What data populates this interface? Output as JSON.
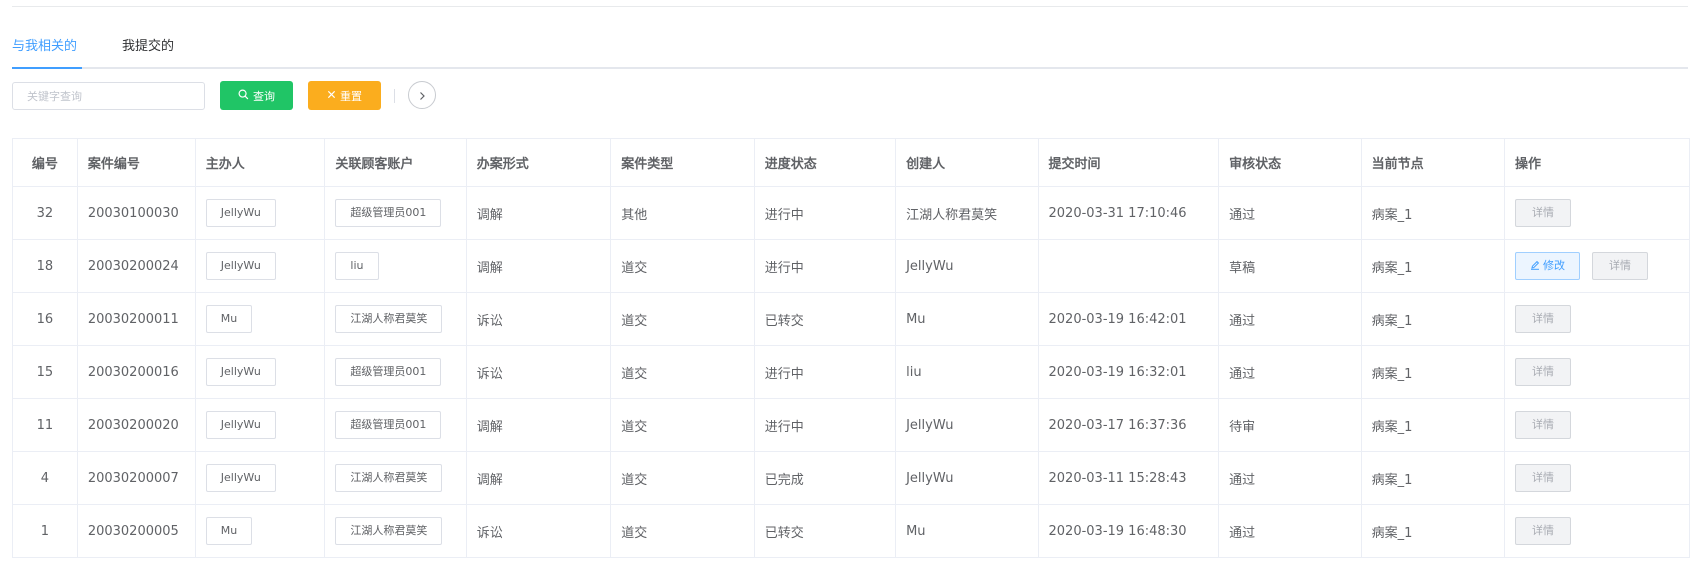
{
  "tabs": {
    "related": "与我相关的",
    "submitted": "我提交的"
  },
  "toolbar": {
    "search_placeholder": "关键字查询",
    "query_label": "查询",
    "reset_label": "重置",
    "colors": {
      "query": "#20c566",
      "reset": "#fbad1e",
      "accent": "#409eff"
    }
  },
  "table": {
    "headers": [
      "编号",
      "案件编号",
      "主办人",
      "关联顾客账户",
      "办案形式",
      "案件类型",
      "进度状态",
      "创建人",
      "提交时间",
      "审核状态",
      "当前节点",
      "操作"
    ],
    "detail_label": "详情",
    "edit_label": "修改",
    "rows": [
      {
        "id": "32",
        "case_no": "20030100030",
        "host": "JellyWu",
        "account": "超级管理员001",
        "mode": "调解",
        "type": "其他",
        "progress": "进行中",
        "creator": "江湖人称君莫笑",
        "time": "2020-03-31 17:10:46",
        "review": "通过",
        "node": "病案_1",
        "editable": false
      },
      {
        "id": "18",
        "case_no": "20030200024",
        "host": "JellyWu",
        "account": "liu",
        "mode": "调解",
        "type": "道交",
        "progress": "进行中",
        "creator": "JellyWu",
        "time": "",
        "review": "草稿",
        "node": "病案_1",
        "editable": true
      },
      {
        "id": "16",
        "case_no": "20030200011",
        "host": "Mu",
        "account": "江湖人称君莫笑",
        "mode": "诉讼",
        "type": "道交",
        "progress": "已转交",
        "creator": "Mu",
        "time": "2020-03-19 16:42:01",
        "review": "通过",
        "node": "病案_1",
        "editable": false
      },
      {
        "id": "15",
        "case_no": "20030200016",
        "host": "JellyWu",
        "account": "超级管理员001",
        "mode": "诉讼",
        "type": "道交",
        "progress": "进行中",
        "creator": "liu",
        "time": "2020-03-19 16:32:01",
        "review": "通过",
        "node": "病案_1",
        "editable": false
      },
      {
        "id": "11",
        "case_no": "20030200020",
        "host": "JellyWu",
        "account": "超级管理员001",
        "mode": "调解",
        "type": "道交",
        "progress": "进行中",
        "creator": "JellyWu",
        "time": "2020-03-17 16:37:36",
        "review": "待审",
        "node": "病案_1",
        "editable": false
      },
      {
        "id": "4",
        "case_no": "20030200007",
        "host": "JellyWu",
        "account": "江湖人称君莫笑",
        "mode": "调解",
        "type": "道交",
        "progress": "已完成",
        "creator": "JellyWu",
        "time": "2020-03-11 15:28:43",
        "review": "通过",
        "node": "病案_1",
        "editable": false
      },
      {
        "id": "1",
        "case_no": "20030200005",
        "host": "Mu",
        "account": "江湖人称君莫笑",
        "mode": "诉讼",
        "type": "道交",
        "progress": "已转交",
        "creator": "Mu",
        "time": "2020-03-19 16:48:30",
        "review": "通过",
        "node": "病案_1",
        "editable": false
      }
    ]
  }
}
